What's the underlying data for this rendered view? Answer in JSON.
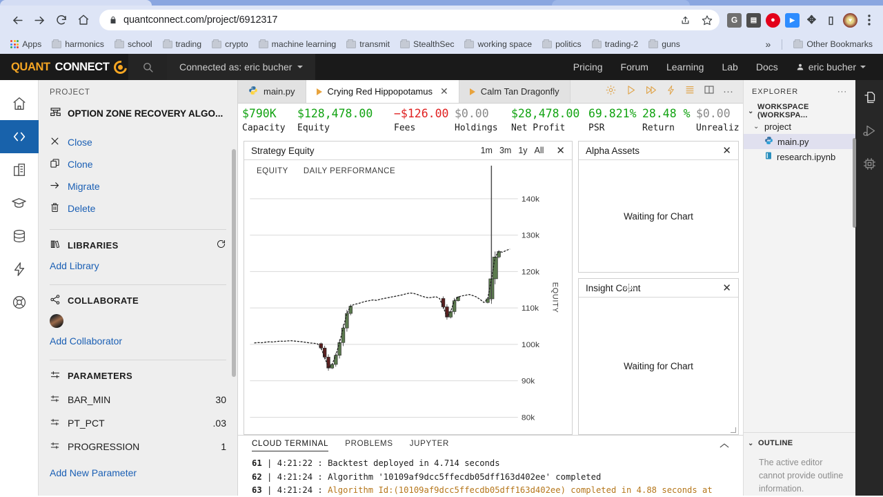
{
  "browser": {
    "url": "quantconnect.com/project/6912317",
    "nav": {
      "back": "back-arrow",
      "forward": "forward-arrow",
      "reload": "reload",
      "home": "home"
    },
    "bookmarks": [
      {
        "label": "Apps",
        "icon": "apps-grid"
      },
      {
        "label": "harmonics",
        "icon": "folder"
      },
      {
        "label": "school",
        "icon": "folder"
      },
      {
        "label": "trading",
        "icon": "folder"
      },
      {
        "label": "crypto",
        "icon": "folder"
      },
      {
        "label": "machine learning",
        "icon": "folder"
      },
      {
        "label": "transmit",
        "icon": "folder"
      },
      {
        "label": "StealthSec",
        "icon": "folder"
      },
      {
        "label": "working space",
        "icon": "folder"
      },
      {
        "label": "politics",
        "icon": "folder"
      },
      {
        "label": "trading-2",
        "icon": "folder"
      },
      {
        "label": "guns",
        "icon": "folder"
      }
    ],
    "overflow_label": "»",
    "other_bookmarks": "Other Bookmarks",
    "extensions": [
      {
        "name": "grammarly-extension",
        "glyph": "G",
        "color": "#6f6f6f"
      },
      {
        "name": "video-extension",
        "glyph": "▣",
        "color": "#4d4d4d"
      },
      {
        "name": "opera-vpn-extension",
        "glyph": "●",
        "color": "#e3001b"
      },
      {
        "name": "zoom-extension",
        "glyph": "▶",
        "color": "#2d8cff"
      },
      {
        "name": "puzzle-extensions-icon",
        "glyph": "✦",
        "color": "#4a4a4a"
      },
      {
        "name": "sidepanel-icon",
        "glyph": "□",
        "color": "#3c3c3c"
      },
      {
        "name": "profile-avatar",
        "glyph": "♥",
        "color": "#7a1f1f"
      }
    ]
  },
  "qc_header": {
    "logo_part1": "QUANT",
    "logo_part2": "CONNECT",
    "connected_as": "Connected as: eric bucher",
    "nav": [
      "Pricing",
      "Forum",
      "Learning",
      "Lab",
      "Docs"
    ],
    "user": "eric bucher"
  },
  "icon_rail": [
    {
      "name": "home",
      "active": false
    },
    {
      "name": "code",
      "active": true
    },
    {
      "name": "organization",
      "active": false
    },
    {
      "name": "learning",
      "active": false
    },
    {
      "name": "datasets",
      "active": false
    },
    {
      "name": "alpha",
      "active": false
    },
    {
      "name": "support",
      "active": false
    }
  ],
  "sidebar": {
    "section_label": "PROJECT",
    "project_name": "OPTION ZONE RECOVERY ALGO...",
    "actions": [
      {
        "label": "Close",
        "icon": "close-icon"
      },
      {
        "label": "Clone",
        "icon": "clone-icon"
      },
      {
        "label": "Migrate",
        "icon": "migrate-arrow-icon"
      },
      {
        "label": "Delete",
        "icon": "trash-icon"
      }
    ],
    "libraries_title": "LIBRARIES",
    "add_library": "Add Library",
    "collaborate_title": "COLLABORATE",
    "add_collaborator": "Add Collaborator",
    "parameters_title": "PARAMETERS",
    "parameters": [
      {
        "name": "BAR_MIN",
        "value": "30"
      },
      {
        "name": "PT_PCT",
        "value": ".03"
      },
      {
        "name": "PROGRESSION",
        "value": "1"
      }
    ],
    "add_new_parameter": "Add New Parameter"
  },
  "tabbar": {
    "tabs": [
      {
        "label": "main.py",
        "icon": "python-icon",
        "active": false,
        "closable": false
      },
      {
        "label": "Crying Red Hippopotamus",
        "icon": "backtest-play-icon",
        "active": true,
        "closable": true
      },
      {
        "label": "Calm Tan Dragonfly",
        "icon": "backtest-play-icon",
        "active": false,
        "closable": false
      }
    ],
    "close_glyph": "✕",
    "actions": [
      "gear-icon",
      "run-icon",
      "fast-backtest-icon",
      "lightning-icon",
      "logs-icon",
      "split-panel-icon",
      "more-icon"
    ]
  },
  "stats": [
    {
      "value": "$790K",
      "label": "Capacity",
      "color": "green"
    },
    {
      "value": "$128,478.00",
      "label": "Equity",
      "color": "green"
    },
    {
      "value": "−$126.00",
      "label": "Fees",
      "color": "red"
    },
    {
      "value": "$0.00",
      "label": "Holdings",
      "color": "gray"
    },
    {
      "value": "$28,478.00",
      "label": "Net Profit",
      "color": "green"
    },
    {
      "value": "69.821%",
      "label": "PSR",
      "color": "green"
    },
    {
      "value": "28.48 %",
      "label": "Return",
      "color": "green"
    },
    {
      "value": "$0.00",
      "label": "Unrealiz",
      "color": "gray"
    }
  ],
  "equity_chart": {
    "title": "Strategy Equity",
    "ranges": [
      "1m",
      "3m",
      "1y",
      "All"
    ],
    "close_glyph": "✕",
    "legend": [
      "EQUITY",
      "DAILY PERFORMANCE"
    ],
    "y_axis_label": "EQUITY"
  },
  "chart_data": {
    "type": "line",
    "title": "Strategy Equity",
    "ylabel": "EQUITY",
    "xlabel": "",
    "grid": true,
    "legend_position": "top-left",
    "ytick_labels": [
      "140k",
      "130k",
      "120k",
      "110k",
      "100k",
      "90k",
      "80k"
    ],
    "ytick_values": [
      140000,
      130000,
      120000,
      110000,
      100000,
      90000,
      80000
    ],
    "ylim": [
      78000,
      143000
    ],
    "series": [
      {
        "name": "EQUITY",
        "type": "line",
        "color": "#222222",
        "values": [
          100400,
          100500,
          100450,
          100600,
          100700,
          100650,
          100800,
          100900,
          100850,
          100950,
          101000,
          100900,
          100800,
          100700,
          100550,
          100400,
          100300,
          100200,
          99000,
          96500,
          93500,
          94500,
          97000,
          100500,
          104500,
          108500,
          110500,
          111000,
          111200,
          111500,
          111800,
          112000,
          112200,
          112100,
          112400,
          112600,
          112800,
          113000,
          113200,
          113400,
          113600,
          113900,
          114100,
          114000,
          113700,
          113300,
          113000,
          112800,
          112900,
          113100,
          112600,
          110300,
          107500,
          109000,
          112000,
          113000,
          113300,
          113500,
          113700,
          113400,
          113000,
          112300,
          111500,
          112500,
          118000,
          124000,
          125500,
          125300,
          125800,
          126200
        ]
      },
      {
        "name": "DAILY PERFORMANCE",
        "type": "candlestick",
        "up_color": "#5b7a4e",
        "down_color": "#5a1f1f",
        "note": "Green/red OHLC bars overlaid on the equity series"
      }
    ]
  },
  "right_cards": [
    {
      "title": "Alpha Assets",
      "body": "Waiting for Chart",
      "close_glyph": "✕"
    },
    {
      "title": "Insight Count",
      "body": "Waiting for Chart",
      "close_glyph": "✕"
    }
  ],
  "terminal": {
    "tabs": [
      "CLOUD TERMINAL",
      "PROBLEMS",
      "JUPYTER"
    ],
    "active_tab": "CLOUD TERMINAL",
    "collapse_glyph": "⌃",
    "lines": [
      {
        "n": "61",
        "time": "4:21:22",
        "text": "Backtest deployed in 4.714 seconds",
        "highlight": false
      },
      {
        "n": "62",
        "time": "4:21:24",
        "text": "Algorithm '10109af9dcc5ffecdb05dff163d402ee' completed",
        "highlight": false
      },
      {
        "n": "63",
        "time": "4:21:24",
        "text": "Algorithm Id:(10109af9dcc5ffecdb05dff163d402ee) completed in 4.88 seconds at",
        "highlight": true
      }
    ]
  },
  "explorer": {
    "title": "EXPLORER",
    "more_glyph": "···",
    "workspace": "WORKSPACE (WORKSPA...",
    "folder": "project",
    "files": [
      {
        "name": "main.py",
        "icon": "python-icon",
        "selected": true
      },
      {
        "name": "research.ipynb",
        "icon": "notebook-icon",
        "selected": false
      }
    ],
    "outline_title": "OUTLINE",
    "outline_message": "The active editor cannot provide outline information."
  },
  "right_rail": [
    {
      "name": "copy-files-icon"
    },
    {
      "name": "run-and-debug-icon"
    },
    {
      "name": "chip-icon"
    }
  ]
}
